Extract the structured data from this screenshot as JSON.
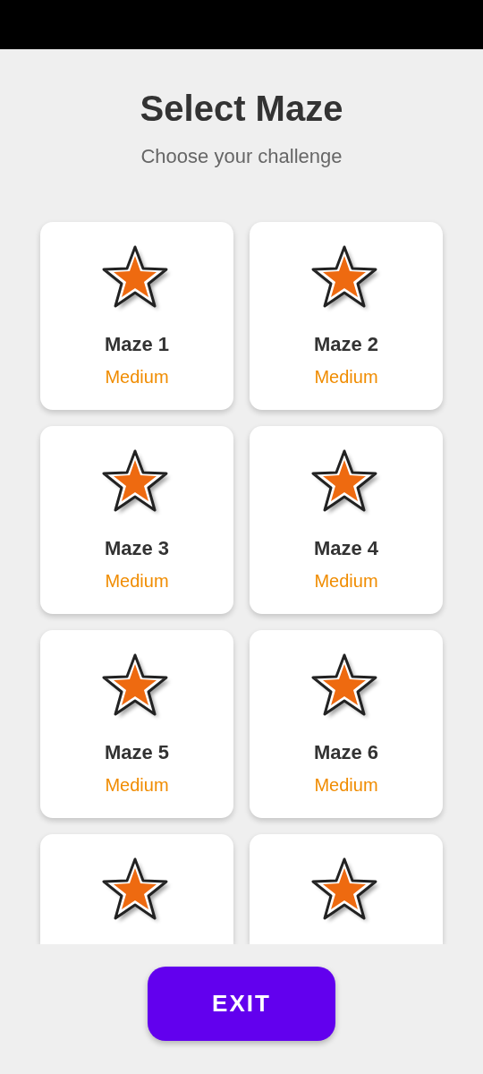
{
  "header": {
    "title": "Select Maze",
    "subtitle": "Choose your challenge"
  },
  "mazes": [
    {
      "name": "Maze 1",
      "difficulty": "Medium",
      "cut_off": false
    },
    {
      "name": "Maze 2",
      "difficulty": "Medium",
      "cut_off": false
    },
    {
      "name": "Maze 3",
      "difficulty": "Medium",
      "cut_off": false
    },
    {
      "name": "Maze 4",
      "difficulty": "Medium",
      "cut_off": false
    },
    {
      "name": "Maze 5",
      "difficulty": "Medium",
      "cut_off": false
    },
    {
      "name": "Maze 6",
      "difficulty": "Medium",
      "cut_off": false
    },
    {
      "cut_off": true
    },
    {
      "cut_off": true
    }
  ],
  "exit_button": {
    "label": "EXIT"
  }
}
